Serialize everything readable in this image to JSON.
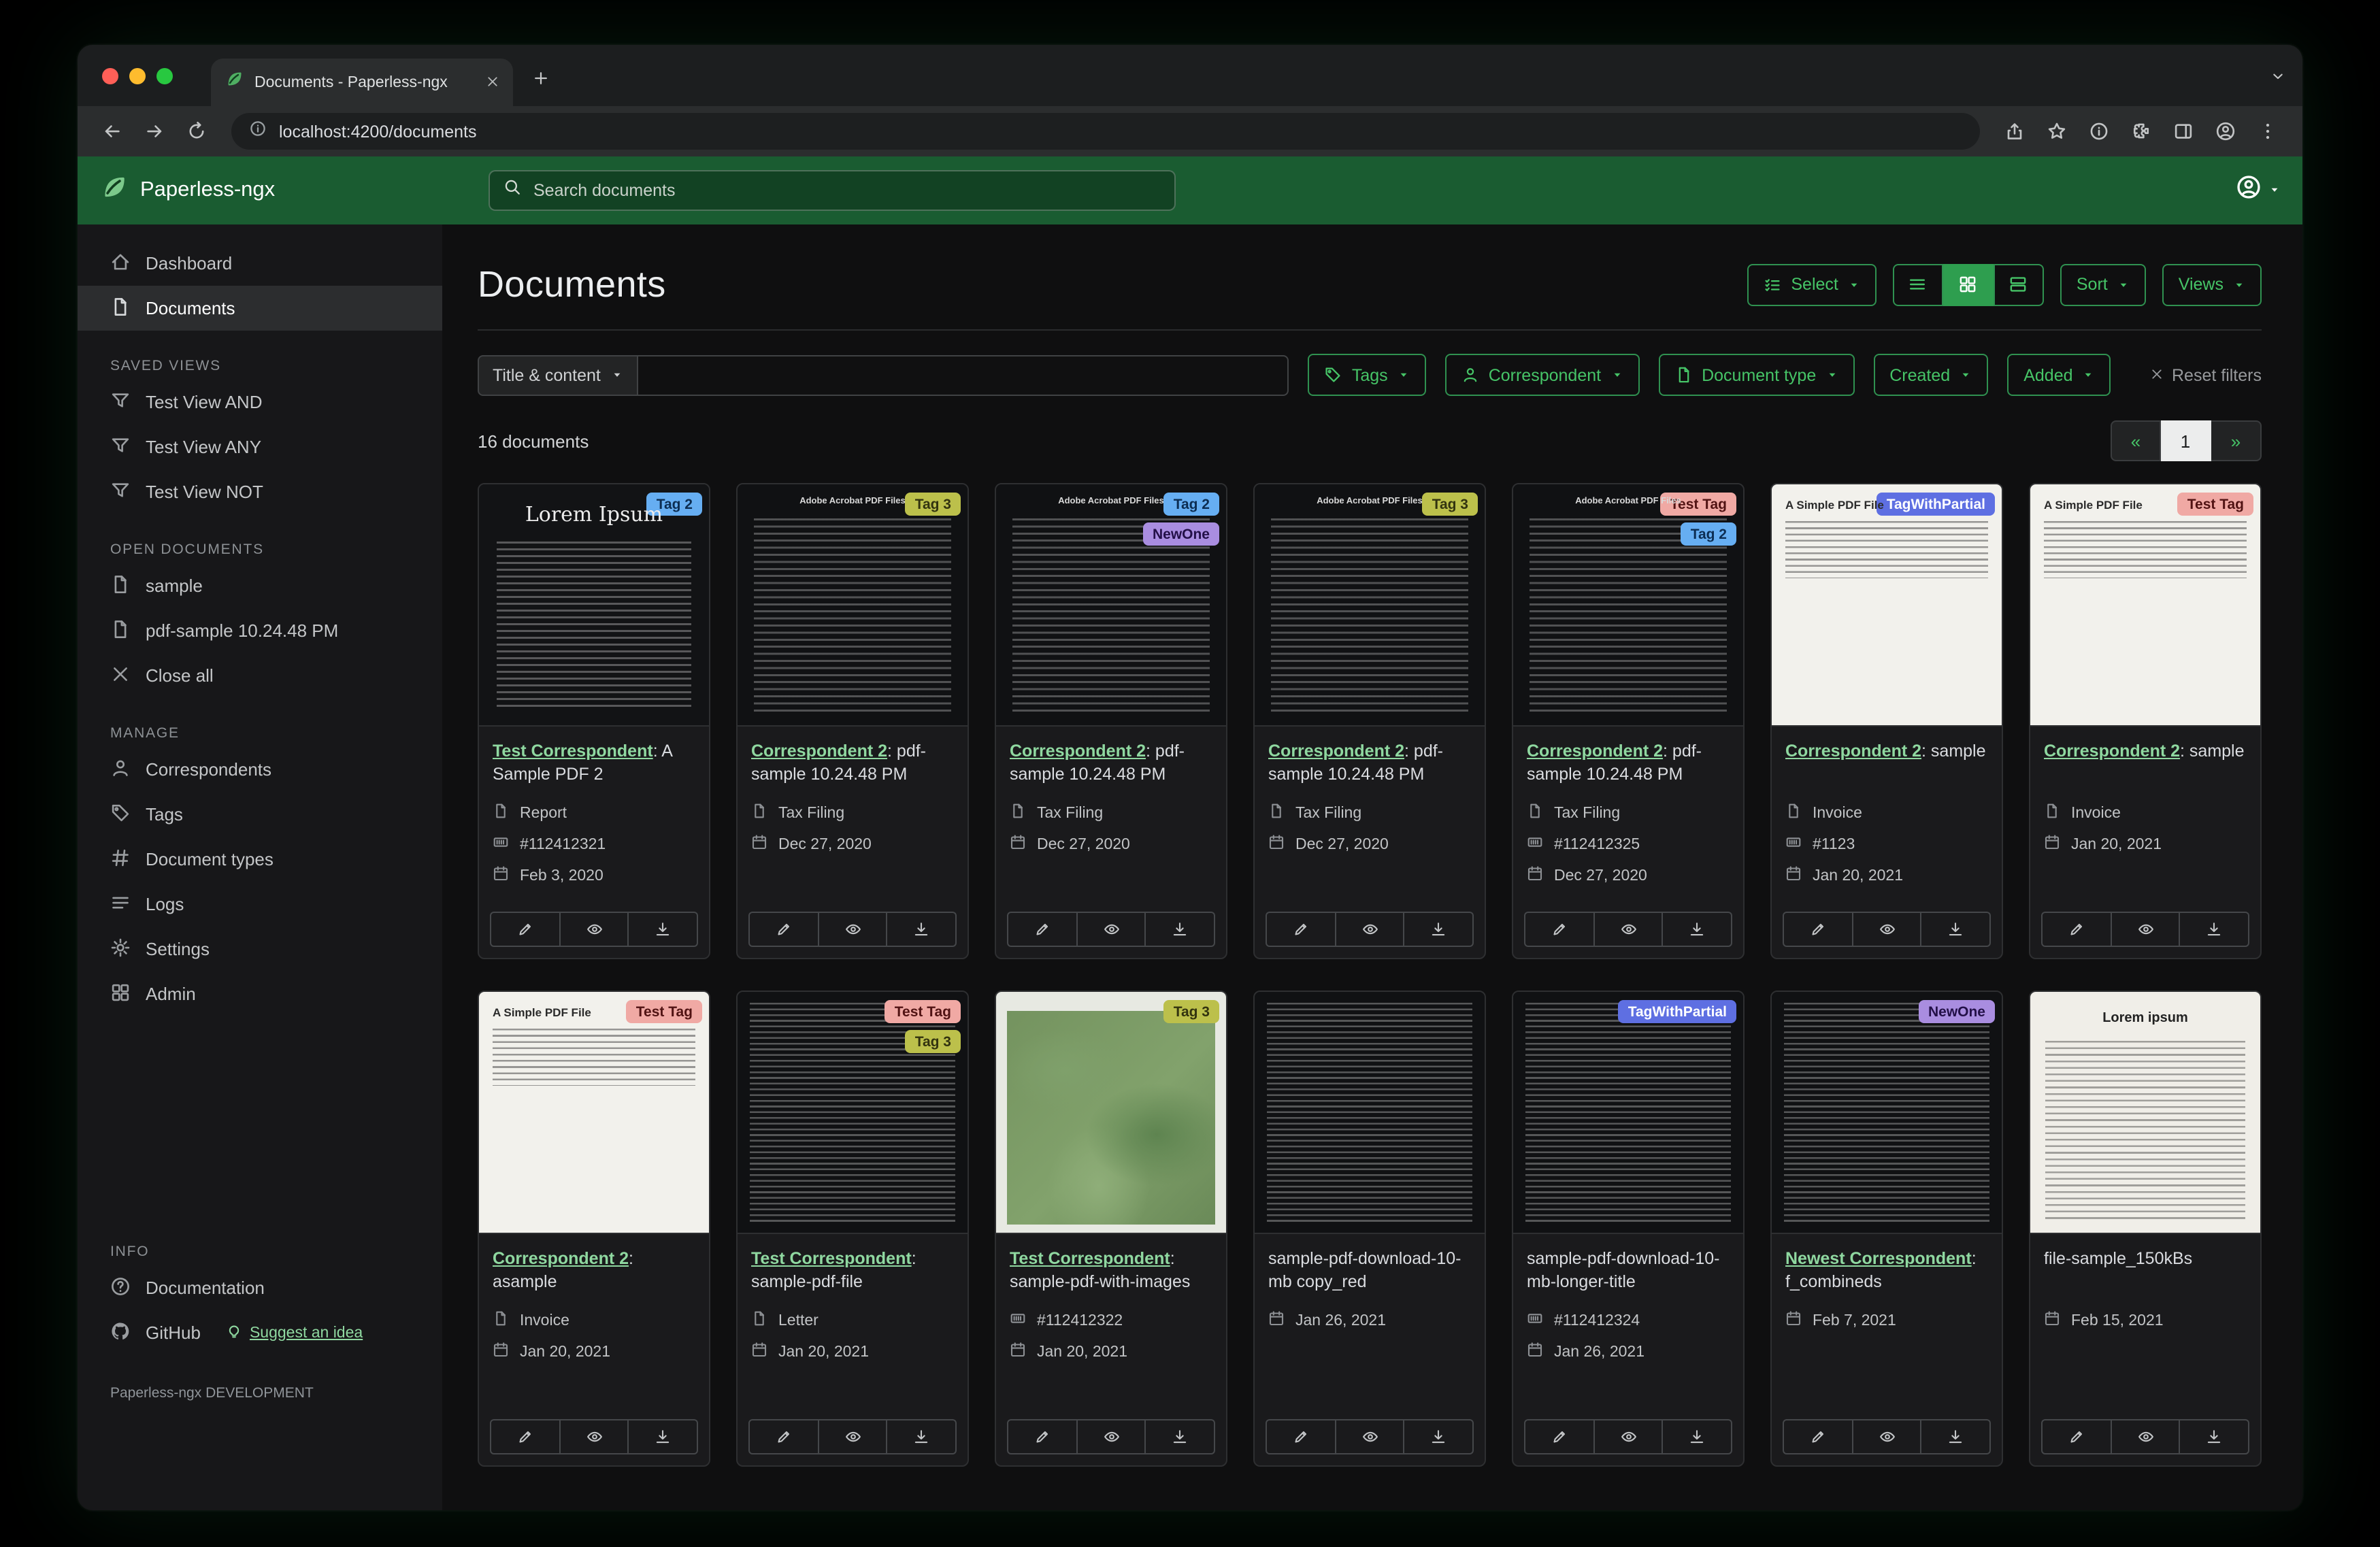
{
  "browser": {
    "tab_title": "Documents - Paperless-ngx",
    "url": "localhost:4200/documents"
  },
  "header": {
    "app_name": "Paperless-ngx",
    "search_placeholder": "Search documents"
  },
  "sidebar": {
    "primary": [
      {
        "label": "Dashboard",
        "icon": "home",
        "active": false
      },
      {
        "label": "Documents",
        "icon": "file",
        "active": true
      }
    ],
    "sections": [
      {
        "heading": "SAVED VIEWS",
        "items": [
          {
            "label": "Test View AND",
            "icon": "filter"
          },
          {
            "label": "Test View ANY",
            "icon": "filter"
          },
          {
            "label": "Test View NOT",
            "icon": "filter"
          }
        ]
      },
      {
        "heading": "OPEN DOCUMENTS",
        "items": [
          {
            "label": "sample",
            "icon": "file"
          },
          {
            "label": "pdf-sample 10.24.48 PM",
            "icon": "file"
          },
          {
            "label": "Close all",
            "icon": "close"
          }
        ]
      },
      {
        "heading": "MANAGE",
        "items": [
          {
            "label": "Correspondents",
            "icon": "person"
          },
          {
            "label": "Tags",
            "icon": "tag"
          },
          {
            "label": "Document types",
            "icon": "hash"
          },
          {
            "label": "Logs",
            "icon": "list"
          },
          {
            "label": "Settings",
            "icon": "gear"
          },
          {
            "label": "Admin",
            "icon": "grid"
          }
        ]
      },
      {
        "heading": "INFO",
        "items": [
          {
            "label": "Documentation",
            "icon": "question"
          },
          {
            "label": "GitHub",
            "icon": "github",
            "extra": {
              "label": "Suggest an idea",
              "icon": "bulb"
            }
          }
        ]
      }
    ],
    "footer": "Paperless-ngx DEVELOPMENT"
  },
  "main": {
    "title": "Documents",
    "toolbar": {
      "select": "Select",
      "sort": "Sort",
      "views": "Views"
    },
    "filters": {
      "field": "Title & content",
      "tags": "Tags",
      "correspondent": "Correspondent",
      "document_type": "Document type",
      "created": "Created",
      "added": "Added",
      "reset": "Reset filters"
    },
    "count": "16 documents",
    "pagination": {
      "prev": "«",
      "current": "1",
      "next": "»"
    }
  },
  "colors": {
    "brand_green": "#1a5c31",
    "accent_green": "#46c467",
    "link_green": "#8fd8a0"
  },
  "tag_colors": {
    "Tag 2": {
      "bg": "#66aef2",
      "fg": "#0c2d52"
    },
    "Tag 3": {
      "bg": "#bcc04b",
      "fg": "#32330f"
    },
    "NewOne": {
      "bg": "#a98de0",
      "fg": "#231048"
    },
    "Test Tag": {
      "bg": "#f0a9a4",
      "fg": "#511313"
    },
    "TagWithPartial": {
      "bg": "#5e6fe2",
      "fg": "#ffffff"
    }
  },
  "cards": [
    {
      "tags": [
        "Tag 2"
      ],
      "preview": {
        "style": "lorem-dark",
        "heading": "Lorem Ipsum"
      },
      "correspondent": "Test Correspondent",
      "title_rest": ": A Sample PDF 2",
      "doc_type": "Report",
      "asn": "#112412321",
      "created": "Feb 3, 2020"
    },
    {
      "tags": [
        "Tag 3"
      ],
      "preview": {
        "style": "acrobat-dark",
        "heading": "Adobe Acrobat PDF Files"
      },
      "correspondent": "Correspondent 2",
      "title_rest": ": pdf-sample 10.24.48 PM",
      "doc_type": "Tax Filing",
      "created": "Dec 27, 2020"
    },
    {
      "tags": [
        "Tag 2",
        "NewOne"
      ],
      "preview": {
        "style": "acrobat-dark",
        "heading": "Adobe Acrobat PDF Files"
      },
      "correspondent": "Correspondent 2",
      "title_rest": ": pdf-sample 10.24.48 PM",
      "doc_type": "Tax Filing",
      "created": "Dec 27, 2020"
    },
    {
      "tags": [
        "Tag 3"
      ],
      "preview": {
        "style": "acrobat-dark",
        "heading": "Adobe Acrobat PDF Files"
      },
      "correspondent": "Correspondent 2",
      "title_rest": ": pdf-sample 10.24.48 PM",
      "doc_type": "Tax Filing",
      "created": "Dec 27, 2020"
    },
    {
      "tags": [
        "Test Tag",
        "Tag 2"
      ],
      "preview": {
        "style": "acrobat-dark",
        "heading": "Adobe Acrobat PDF Files"
      },
      "correspondent": "Correspondent 2",
      "title_rest": ": pdf-sample 10.24.48 PM",
      "doc_type": "Tax Filing",
      "asn": "#112412325",
      "created": "Dec 27, 2020"
    },
    {
      "tags": [
        "TagWithPartial"
      ],
      "preview": {
        "style": "simple-white",
        "heading": "A Simple PDF File"
      },
      "correspondent": "Correspondent 2",
      "title_rest": ": sample",
      "doc_type": "Invoice",
      "asn": "#1123",
      "created": "Jan 20, 2021"
    },
    {
      "tags": [
        "Test Tag"
      ],
      "preview": {
        "style": "simple-white",
        "heading": "A Simple PDF File"
      },
      "correspondent": "Correspondent 2",
      "title_rest": ": sample",
      "doc_type": "Invoice",
      "created": "Jan 20, 2021"
    },
    {
      "tags": [
        "Test Tag"
      ],
      "preview": {
        "style": "simple-white",
        "heading": "A Simple PDF File"
      },
      "correspondent": "Correspondent 2",
      "title_rest": ": asample",
      "doc_type": "Invoice",
      "created": "Jan 20, 2021"
    },
    {
      "tags": [
        "Test Tag",
        "Tag 3"
      ],
      "preview": {
        "style": "dense-dark"
      },
      "correspondent": "Test Correspondent",
      "title_rest": ": sample-pdf-file",
      "doc_type": "Letter",
      "created": "Jan 20, 2021"
    },
    {
      "tags": [
        "Tag 3"
      ],
      "preview": {
        "style": "map"
      },
      "correspondent": "Test Correspondent",
      "title_rest": ": sample-pdf-with-images",
      "asn": "#112412322",
      "created": "Jan 20, 2021"
    },
    {
      "tags": [],
      "preview": {
        "style": "dense-dark"
      },
      "title": "sample-pdf-download-10-mb copy_red",
      "created": "Jan 26, 2021"
    },
    {
      "tags": [
        "TagWithPartial"
      ],
      "preview": {
        "style": "dense-dark"
      },
      "title": "sample-pdf-download-10-mb-longer-title",
      "asn": "#112412324",
      "created": "Jan 26, 2021"
    },
    {
      "tags": [
        "NewOne"
      ],
      "preview": {
        "style": "dense-dark"
      },
      "correspondent": "Newest Correspondent",
      "title_rest": ": f_combineds",
      "created": "Feb 7, 2021"
    },
    {
      "tags": [],
      "preview": {
        "style": "lorem-white",
        "heading": "Lorem ipsum"
      },
      "title": "file-sample_150kBs",
      "created": "Feb 15, 2021"
    }
  ]
}
